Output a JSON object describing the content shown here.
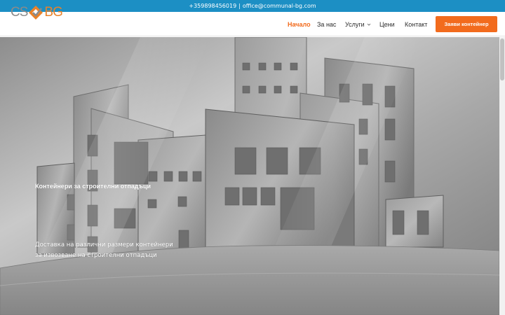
{
  "topbar": {
    "phone": "+359898456019",
    "separator": "|",
    "email": "office@communal-bg.com"
  },
  "logo": {
    "left": "CS",
    "right": "BG",
    "colors": {
      "gray": "#8a8a8a",
      "orange": "#e8822a"
    }
  },
  "nav": {
    "items": [
      {
        "label": "Начало",
        "active": true
      },
      {
        "label": "За нас",
        "active": false
      },
      {
        "label": "Услуги",
        "active": false,
        "icon": "chevron-down-icon"
      },
      {
        "label": "Цени",
        "active": false
      },
      {
        "label": "Контакт",
        "active": false
      }
    ],
    "cta_label": "Заяви контейнер"
  },
  "hero": {
    "title": "Контейнери за строителни отпадъци",
    "subtitle": "Доставка на различни размери контейнери за извозване на строителни отпадъци"
  },
  "colors": {
    "topbar": "#1c8fc4",
    "accent": "#f26b1d",
    "active_nav": "#f26b1d"
  }
}
